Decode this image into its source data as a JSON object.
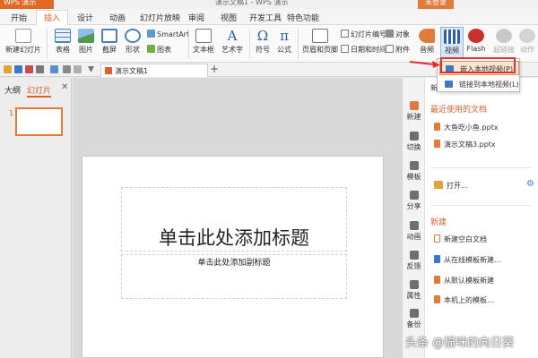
{
  "titlebar": {
    "app": "WPS 演示",
    "title": "演示文稿1 - WPS 演示",
    "login": "未登录"
  },
  "menu_tabs": [
    "开始",
    "插入",
    "设计",
    "动画",
    "幻灯片放映",
    "审阅",
    "视图",
    "开发工具",
    "特色功能"
  ],
  "ribbon": {
    "new_slide": "新建幻灯片",
    "table": "表格",
    "picture": "图片",
    "screenshot": "截屏",
    "shape": "形状",
    "smartart": "SmartArt",
    "chart": "图表",
    "textbox": "文本框",
    "wordart": "艺术字",
    "symbol": "符号",
    "formula": "公式",
    "header_footer": "页眉和页脚",
    "slide_number": "幻灯片编号",
    "date_time": "日期和时间",
    "object": "对象",
    "attachment": "附件",
    "audio": "音频",
    "video": "视频",
    "flash": "Flash",
    "hyperlink": "超链接",
    "action": "动作"
  },
  "doc_tab": {
    "label": "演示文稿1"
  },
  "left_panel": {
    "tab_outline": "大纲",
    "tab_slides": "幻灯片",
    "slide_number": "1"
  },
  "slide": {
    "title_placeholder": "单击此处添加标题",
    "subtitle_placeholder": "单击此处添加副标题"
  },
  "video_menu": {
    "embed": "嵌入本地视频(P)",
    "link": "链接到本地视频(L)"
  },
  "side_strip": [
    "新建",
    "切换",
    "模板",
    "分享",
    "动画",
    "反馈",
    "属性",
    "备份"
  ],
  "task_pane": {
    "header": "新建",
    "recent_title": "最近使用的文档",
    "recent_files": [
      "大鱼吃小鱼.pptx",
      "演示文稿3.pptx"
    ],
    "open_label": "打开...",
    "new_title": "新建",
    "new_items": [
      "新建空白文档",
      "从在线模板新建...",
      "从默认模板新建",
      "本机上的模板..."
    ]
  },
  "watermark": "头条 @猫咪的向日葵",
  "colors": {
    "accent": "#d9632b",
    "highlight": "#fce4d3",
    "callout": "#e03030"
  }
}
